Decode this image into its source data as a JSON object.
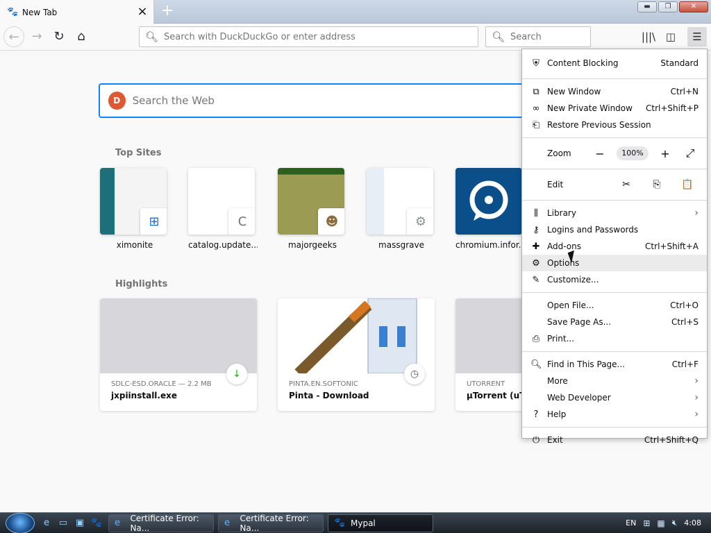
{
  "tab": {
    "title": "New Tab"
  },
  "window": {
    "minimize": "▬",
    "restore": "❐",
    "close": "✕"
  },
  "nav": {
    "url_placeholder": "Search with DuckDuckGo or enter address",
    "search_placeholder": "Search"
  },
  "content": {
    "search_placeholder": "Search the Web",
    "ddg_logo": "D",
    "top_sites_title": "Top Sites",
    "highlights_title": "Highlights",
    "top_sites": [
      {
        "label": "ximonite",
        "badge": "⊞"
      },
      {
        "label": "catalog.update....",
        "badge": "C"
      },
      {
        "label": "majorgeeks",
        "badge": "☻"
      },
      {
        "label": "massgrave",
        "badge": "⚙"
      },
      {
        "label": "chromium.infor...",
        "badge": ""
      }
    ],
    "highlights": [
      {
        "host": "SDLC-ESD.ORACLE — 2.2 MB",
        "title": "jxpiinstall.exe",
        "badge": "↓"
      },
      {
        "host": "PINTA.EN.SOFTONIC",
        "title": "Pinta - Download",
        "badge": "◷"
      },
      {
        "host": "UTORRENT",
        "title": "µTorrent (uTo",
        "badge": ""
      }
    ]
  },
  "menu": {
    "content_blocking": {
      "label": "Content Blocking",
      "value": "Standard"
    },
    "new_window": {
      "label": "New Window",
      "shortcut": "Ctrl+N"
    },
    "new_private": {
      "label": "New Private Window",
      "shortcut": "Ctrl+Shift+P"
    },
    "restore_session": {
      "label": "Restore Previous Session"
    },
    "zoom": {
      "label": "Zoom",
      "value": "100%",
      "minus": "−",
      "plus": "+",
      "fullscreen": "⤢"
    },
    "edit": {
      "label": "Edit",
      "cut": "✂",
      "copy": "⎘",
      "paste": "📋"
    },
    "library": {
      "label": "Library"
    },
    "logins": {
      "label": "Logins and Passwords"
    },
    "addons": {
      "label": "Add-ons",
      "shortcut": "Ctrl+Shift+A"
    },
    "options": {
      "label": "Options"
    },
    "customize": {
      "label": "Customize..."
    },
    "open_file": {
      "label": "Open File...",
      "shortcut": "Ctrl+O"
    },
    "save_page": {
      "label": "Save Page As...",
      "shortcut": "Ctrl+S"
    },
    "print": {
      "label": "Print..."
    },
    "find": {
      "label": "Find in This Page...",
      "shortcut": "Ctrl+F"
    },
    "more": {
      "label": "More"
    },
    "web_dev": {
      "label": "Web Developer"
    },
    "help": {
      "label": "Help"
    },
    "exit": {
      "label": "Exit",
      "shortcut": "Ctrl+Shift+Q"
    }
  },
  "taskbar": {
    "tasks": [
      {
        "label": "Certificate Error: Na...",
        "icon": "e"
      },
      {
        "label": "Certificate Error: Na...",
        "icon": "e"
      },
      {
        "label": "Mypal",
        "icon": "🐾"
      }
    ],
    "lang": "EN",
    "time": "4:08"
  }
}
